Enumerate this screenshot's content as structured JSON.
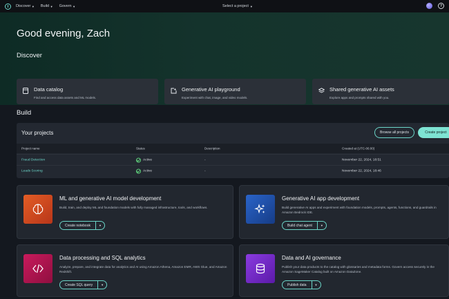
{
  "nav": {
    "items": [
      "Discover",
      "Build",
      "Govern"
    ],
    "center": "Select a project"
  },
  "hero": {
    "greeting": "Good evening, Zach",
    "discover_heading": "Discover",
    "cards": [
      {
        "title": "Data catalog",
        "desc": "Find and access data assets and ML models."
      },
      {
        "title": "Generative AI playground",
        "desc": "Experiment with chat, image, and video models."
      },
      {
        "title": "Shared generative AI assets",
        "desc": "Explore apps and prompts shared with you."
      }
    ]
  },
  "build": {
    "heading": "Build",
    "projects_title": "Your projects",
    "browse_label": "Browse all projects",
    "create_label": "Create project",
    "columns": [
      "Project name",
      "Status",
      "Description",
      "Created at (UTC-06:00)"
    ],
    "rows": [
      {
        "name": "Fraud Detection",
        "status": "Active",
        "desc": "-",
        "created": "November 22, 2024, 18:51"
      },
      {
        "name": "Leads Scoring",
        "status": "Active",
        "desc": "-",
        "created": "November 22, 2024, 18:46"
      }
    ]
  },
  "features": [
    {
      "title": "ML and generative AI model development",
      "desc": "Build, train, and deploy ML and foundation models with fully managed infrastructure, tools, and workflows.",
      "button": "Create notebook",
      "color": "#d2461c"
    },
    {
      "title": "Generative AI app development",
      "desc": "Build generative AI apps and experiment with foundation models, prompts, agents, functions, and guardrails in Amazon Bedrock IDE.",
      "button": "Build chat agent",
      "color": "#1f4fa8"
    },
    {
      "title": "Data processing and SQL analytics",
      "desc": "Analyze, prepare, and integrate data for analytics and AI using Amazon Athena, Amazon EMR, AWS Glue, and Amazon Redshift.",
      "button": "Create SQL query",
      "color": "#b0134f"
    },
    {
      "title": "Data and AI governance",
      "desc": "Publish your data products to the catalog with glossaries and metadata forms. Govern access securely in the Amazon SageMaker Catalog built on Amazon DataZone.",
      "button": "Publish data",
      "color": "#7322c9"
    }
  ],
  "colors": {
    "accent": "#6bd5c8",
    "active": "#5fd07c"
  }
}
